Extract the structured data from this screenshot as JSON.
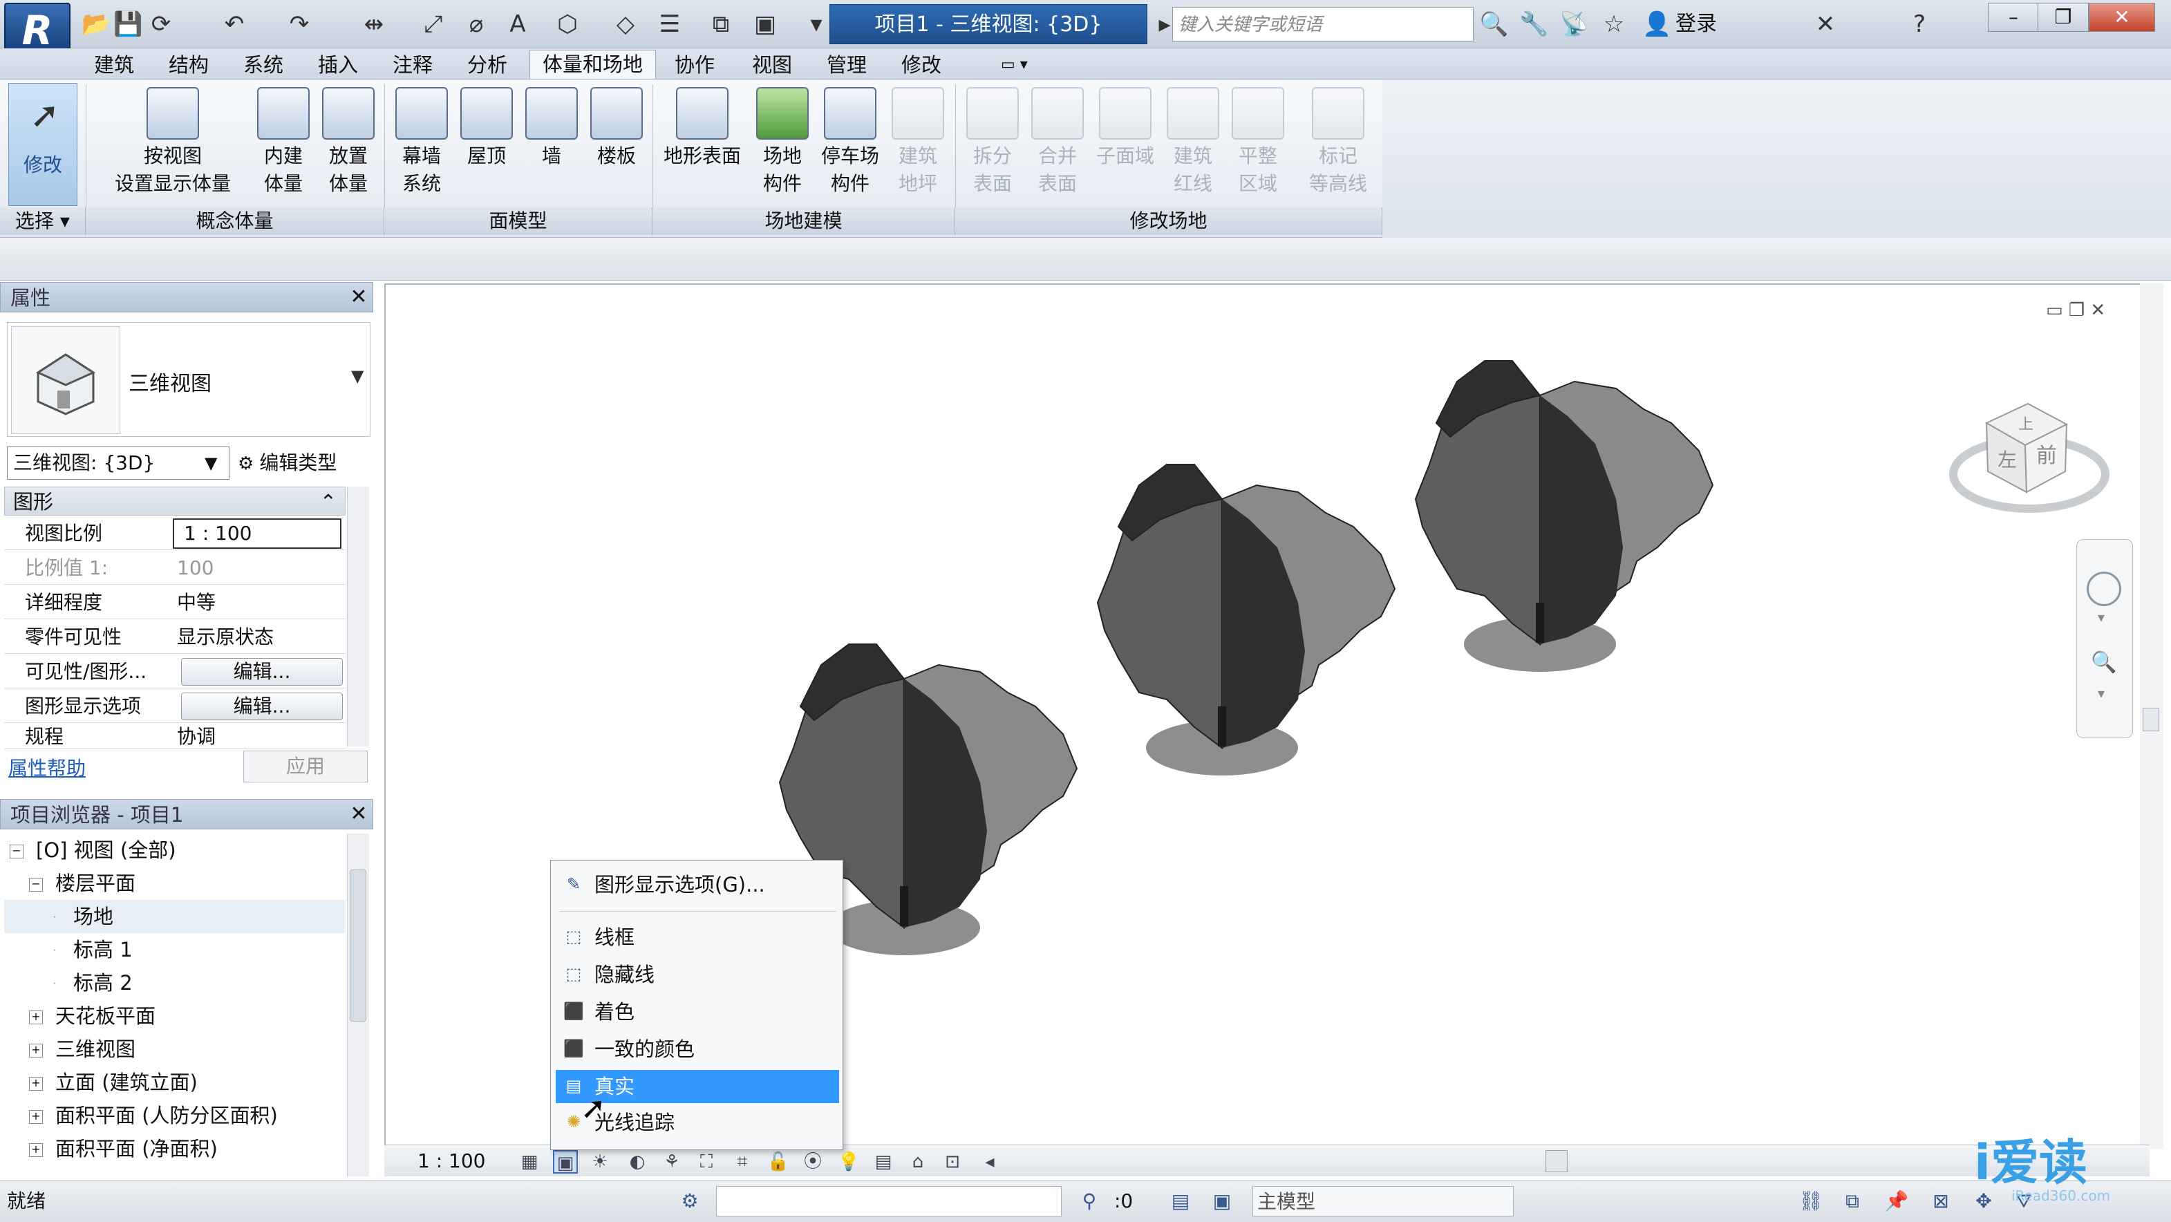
{
  "app": {
    "title": "项目1 - 三维视图: {3D}",
    "search_placeholder": "键入关键字或短语",
    "login_label": "登录",
    "logo_letter": "R"
  },
  "tabs": [
    "建筑",
    "结构",
    "系统",
    "插入",
    "注释",
    "分析",
    "体量和场地",
    "协作",
    "视图",
    "管理",
    "修改"
  ],
  "active_tab": "体量和场地",
  "ribbon": {
    "modify_label": "修改",
    "groups": {
      "select": "选择 ▾",
      "concept": "概念体量",
      "face": "面模型",
      "site": "场地建模",
      "modify_site": "修改场地"
    },
    "buttons": {
      "show_mass": "按视图\n设置显示体量",
      "inplace_mass": "内建\n体量",
      "place_mass": "放置\n体量",
      "curtain_system": "幕墙\n系统",
      "roof": "屋顶",
      "wall": "墙",
      "floor": "楼板",
      "toposurface": "地形表面",
      "site_component": "场地\n构件",
      "parking": "停车场\n构件",
      "building_pad": "建筑\n地坪",
      "split_surface": "拆分\n表面",
      "merge_surface": "合并\n表面",
      "subregion": "子面域",
      "property_line": "建筑\n红线",
      "graded_region": "平整\n区域",
      "label_contours": "标记\n等高线"
    }
  },
  "properties": {
    "header": "属性",
    "type_name": "三维视图",
    "view_selector": "三维视图: {3D}",
    "edit_type": "编辑类型",
    "section": "图形",
    "rows": [
      {
        "key": "视图比例",
        "value": "1 : 100"
      },
      {
        "key": "比例值 1:",
        "value": "100"
      },
      {
        "key": "详细程度",
        "value": "中等"
      },
      {
        "key": "零件可见性",
        "value": "显示原状态"
      },
      {
        "key": "可见性/图形...",
        "value": "编辑..."
      },
      {
        "key": "图形显示选项",
        "value": "编辑..."
      },
      {
        "key": "规程",
        "value": "协调"
      }
    ],
    "help_link": "属性帮助",
    "apply": "应用"
  },
  "project_browser": {
    "header": "项目浏览器 - 项目1",
    "nodes": [
      {
        "label": "[O] 视图 (全部)",
        "level": 0,
        "exp": "−"
      },
      {
        "label": "楼层平面",
        "level": 1,
        "exp": "−"
      },
      {
        "label": "场地",
        "level": 2,
        "exp": ""
      },
      {
        "label": "标高 1",
        "level": 2,
        "exp": ""
      },
      {
        "label": "标高 2",
        "level": 2,
        "exp": ""
      },
      {
        "label": "天花板平面",
        "level": 1,
        "exp": "+"
      },
      {
        "label": "三维视图",
        "level": 1,
        "exp": "+"
      },
      {
        "label": "立面 (建筑立面)",
        "level": 1,
        "exp": "+"
      },
      {
        "label": "面积平面 (人防分区面积)",
        "level": 1,
        "exp": "+"
      },
      {
        "label": "面积平面 (净面积)",
        "level": 1,
        "exp": "+"
      }
    ]
  },
  "view_control": {
    "scale": "1 : 100"
  },
  "context_menu": {
    "items": [
      {
        "label": "图形显示选项(G)...",
        "icon": "graphics-options-icon"
      },
      {
        "label": "线框",
        "icon": "wireframe-icon"
      },
      {
        "label": "隐藏线",
        "icon": "hidden-line-icon"
      },
      {
        "label": "着色",
        "icon": "shaded-icon"
      },
      {
        "label": "一致的颜色",
        "icon": "consistent-colors-icon"
      },
      {
        "label": "真实",
        "icon": "realistic-icon",
        "highlighted": true
      },
      {
        "label": "光线追踪",
        "icon": "raytrace-icon"
      }
    ]
  },
  "viewcube": {
    "top_label": "上",
    "front_label": "前",
    "left_label": "左"
  },
  "status": {
    "text": "就绪",
    "count": ":0",
    "model": "主模型"
  },
  "watermark": {
    "brand": "爱读",
    "site": "iRead360.com"
  },
  "colors": {
    "accent": "#3399ff",
    "title_blue": "#2e6bb4",
    "tree_dark": "#2f2f2f",
    "tree_mid": "#5e5e5e",
    "tree_light": "#8a8a8a"
  }
}
